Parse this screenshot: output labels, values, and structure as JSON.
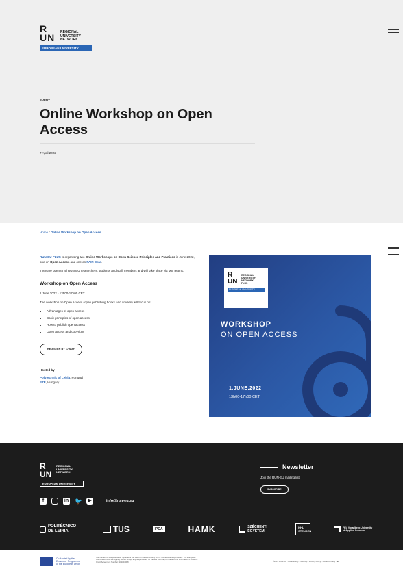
{
  "header": {
    "logo": {
      "letters_top": "R",
      "letters_bottom": "UN",
      "words": [
        "REGIONAL",
        "UNIVERSITY",
        "NETWORK"
      ],
      "bar": "EUROPEAN UNIVERSITY"
    }
  },
  "hero": {
    "label": "EVENT",
    "title": "Online Workshop on Open Access",
    "date": "7 April 2022"
  },
  "breadcrumb": {
    "home": "Home",
    "separator": "/",
    "current": "Online Workshop on Open Access"
  },
  "content": {
    "intro_link": "RUN-EU PLUS",
    "intro_1": " is organising two ",
    "intro_bold": "Online Workshops on Open Science Principles and Practices",
    "intro_2": " in June 2022, one on ",
    "intro_oa": "Open Access",
    "intro_3": " and one on ",
    "intro_fair": "FAIR Data",
    "intro_4": ".",
    "open_to": "They are open to all RUN-EU researchers, students and staff members and will take place via MS Teams.",
    "section_title": "Workshop on Open Access",
    "section_date": "1 June 2022 - 13h00-17h00 CET",
    "focus": "The workshop on Open Access (open publishing books and articles) will focus on:",
    "bullets": [
      "Advantages of open access",
      "Basic principles of open access",
      "How to publish open access",
      "Open access and copyright"
    ],
    "register_label": "REGISTER BY 17 MAY",
    "hosted_label": "Hosted by",
    "host1_name": "Polytechnic of Leiria",
    "host1_country": ", Portugal",
    "host2_name": "SZE",
    "host2_country": ", Hungary"
  },
  "poster": {
    "logo_letters_top": "R",
    "logo_letters_bottom": "UN",
    "logo_words": [
      "REGIONAL",
      "UNIVERSITY",
      "NETWORK",
      "PLUS"
    ],
    "logo_bar": "EUROPEAN UNIVERSITY",
    "line1": "WORKSHOP",
    "line2": "ON OPEN ACCESS",
    "date": "1.JUNE.2022",
    "time": "13h00-17h00 CET",
    "colors": {
      "dark": "#223e82",
      "mid": "#2b57a4",
      "light": "#3069b9"
    }
  },
  "footer": {
    "logo": {
      "letters_top": "R",
      "letters_bottom": "UN",
      "words": [
        "REGIONAL",
        "UNIVERSITY",
        "NETWORK"
      ],
      "bar": "EUROPEAN UNIVERSITY"
    },
    "socials": [
      "facebook-icon",
      "instagram-icon",
      "linkedin-icon",
      "twitter-icon",
      "youtube-icon"
    ],
    "email": "info@run-eu.eu",
    "newsletter_title": "Newsletter",
    "newsletter_sub": "Join the RUN-EU mailing list",
    "subscribe_label": "SUBSCRIBE",
    "partners": [
      {
        "name": "POLITÉCNICO DE LEIRIA"
      },
      {
        "name": "TUS"
      },
      {
        "name": "IPCA"
      },
      {
        "name": "HAMK"
      },
      {
        "name": "SZÉCHENYI EGYETEM"
      },
      {
        "name": "NHL STENDEN"
      },
      {
        "name": "FHV Vorarlberg University of Applied Sciences"
      }
    ]
  },
  "bottom": {
    "eu_text": [
      "Co-funded by the",
      "Erasmus+ Programme",
      "of the European Union"
    ],
    "disclaimer": "The content of this publication represents the views of the author only and is his/her sole responsibility. The European Commission and the Agency do not accept any responsibility for the use that may be made of the information it contains. Grant Agreement Number: 101004068",
    "copyright": "©2022 RUN-EU · Accessibility · Sitemap · Privacy Policy · Cookies Policy · ▲"
  }
}
